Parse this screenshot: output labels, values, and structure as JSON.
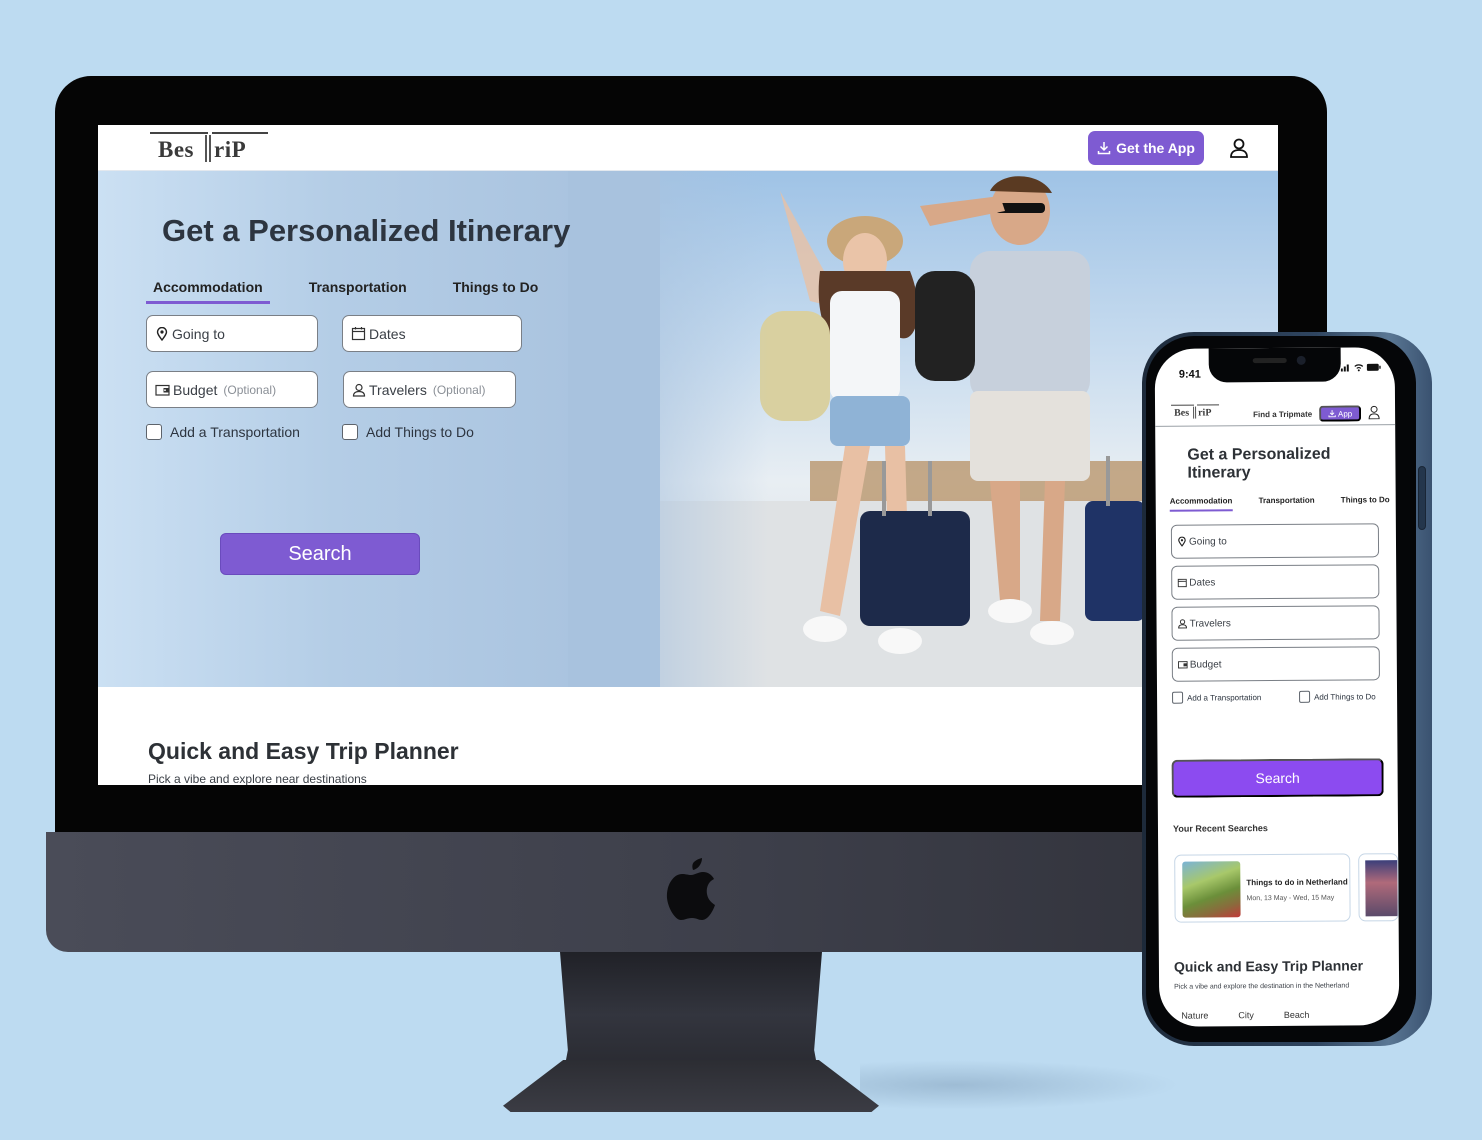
{
  "desktop": {
    "logo": {
      "left": "Bes",
      "right": "riP"
    },
    "header": {
      "get_app_label": "Get the App"
    },
    "hero": {
      "title": "Get a Personalized Itinerary",
      "tabs": [
        {
          "label": "Accommodation",
          "active": true
        },
        {
          "label": "Transportation",
          "active": false
        },
        {
          "label": "Things to Do",
          "active": false
        }
      ],
      "fields": {
        "going_to": {
          "placeholder": "Going to"
        },
        "dates": {
          "placeholder": "Dates"
        },
        "budget": {
          "placeholder": "Budget",
          "hint": "(Optional)"
        },
        "travelers": {
          "placeholder": "Travelers",
          "hint": "(Optional)"
        }
      },
      "checkboxes": {
        "transportation": "Add a Transportation",
        "things_to_do": "Add Things to Do"
      },
      "search_label": "Search"
    },
    "planner": {
      "title": "Quick and Easy Trip Planner",
      "subtitle": "Pick a vibe and explore near destinations"
    }
  },
  "mobile": {
    "status": {
      "time": "9:41"
    },
    "logo": {
      "left": "Bes",
      "right": "riP"
    },
    "header": {
      "find_tripmate": "Find a Tripmate",
      "app_label": "App"
    },
    "hero": {
      "title": "Get a Personalized Itinerary",
      "tabs": [
        {
          "label": "Accommodation",
          "active": true
        },
        {
          "label": "Transportation",
          "active": false
        },
        {
          "label": "Things to Do",
          "active": false
        }
      ],
      "fields": {
        "going_to": "Going to",
        "dates": "Dates",
        "travelers": "Travelers",
        "budget": "Budget"
      },
      "checkboxes": {
        "transportation": "Add a Transportation",
        "things_to_do": "Add Things to Do"
      },
      "search_label": "Search"
    },
    "recent": {
      "label": "Your Recent Searches",
      "items": [
        {
          "title": "Things to do in Netherland",
          "dates": "Mon, 13 May - Wed, 15 May"
        }
      ]
    },
    "planner": {
      "title": "Quick and Easy Trip Planner",
      "subtitle": "Pick a vibe and explore the destination in the Netherland",
      "vibes": [
        "Nature",
        "City",
        "Beach"
      ]
    }
  },
  "colors": {
    "brand_purple": "#7e5bd2",
    "mobile_search_purple": "#8c4bf0",
    "background": "#bddbf1"
  }
}
